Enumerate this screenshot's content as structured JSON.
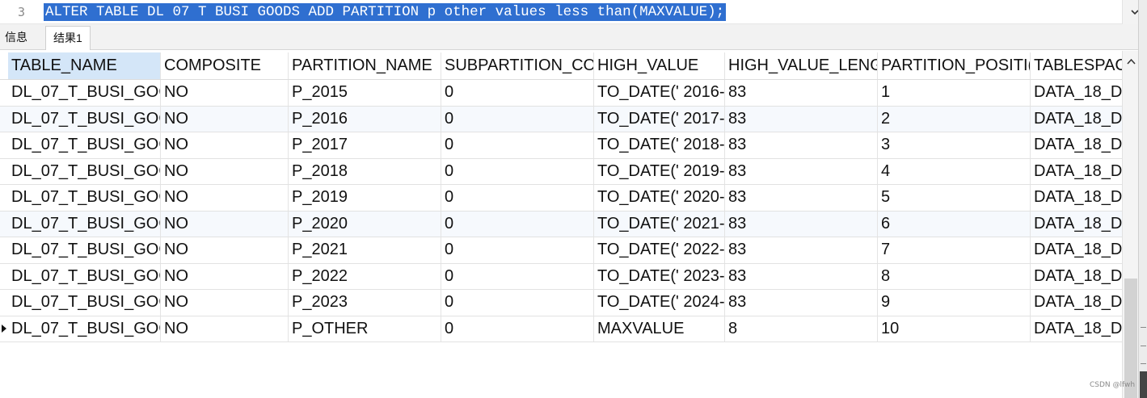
{
  "editor": {
    "line_number": "3",
    "sql": "ALTER TABLE DL 07 T BUSI GOODS ADD PARTITION p other values less than(MAXVALUE);"
  },
  "tabs": {
    "info_label": "信息",
    "result_label": "结果1"
  },
  "table": {
    "columns": [
      "TABLE_NAME",
      "COMPOSITE",
      "PARTITION_NAME",
      "SUBPARTITION_CO",
      "HIGH_VALUE",
      "HIGH_VALUE_LENG",
      "PARTITION_POSITI(",
      "TABLESPAC"
    ],
    "rows": [
      [
        "DL_07_T_BUSI_GOO",
        "NO",
        "P_2015",
        "0",
        "TO_DATE(' 2016-",
        "83",
        "1",
        "DATA_18_D."
      ],
      [
        "DL_07_T_BUSI_GOO",
        "NO",
        "P_2016",
        "0",
        "TO_DATE(' 2017-",
        "83",
        "2",
        "DATA_18_D."
      ],
      [
        "DL_07_T_BUSI_GOO",
        "NO",
        "P_2017",
        "0",
        "TO_DATE(' 2018-",
        "83",
        "3",
        "DATA_18_D."
      ],
      [
        "DL_07_T_BUSI_GOO",
        "NO",
        "P_2018",
        "0",
        "TO_DATE(' 2019-",
        "83",
        "4",
        "DATA_18_D."
      ],
      [
        "DL_07_T_BUSI_GOO",
        "NO",
        "P_2019",
        "0",
        "TO_DATE(' 2020-",
        "83",
        "5",
        "DATA_18_D."
      ],
      [
        "DL_07_T_BUSI_GOO",
        "NO",
        "P_2020",
        "0",
        "TO_DATE(' 2021-",
        "83",
        "6",
        "DATA_18_D."
      ],
      [
        "DL_07_T_BUSI_GOO",
        "NO",
        "P_2021",
        "0",
        "TO_DATE(' 2022-",
        "83",
        "7",
        "DATA_18_D."
      ],
      [
        "DL_07_T_BUSI_GOO",
        "NO",
        "P_2022",
        "0",
        "TO_DATE(' 2023-",
        "83",
        "8",
        "DATA_18_D."
      ],
      [
        "DL_07_T_BUSI_GOO",
        "NO",
        "P_2023",
        "0",
        "TO_DATE(' 2024-",
        "83",
        "9",
        "DATA_18_D."
      ],
      [
        "DL_07_T_BUSI_GOO",
        "NO",
        "P_OTHER",
        "0",
        "MAXVALUE",
        "8",
        "10",
        "DATA_18_D."
      ]
    ],
    "current_row_index": 9
  },
  "watermark": "CSDN @lfwh",
  "colors": {
    "selection": "#2f6fd0",
    "header_selected": "#d4e6f8"
  }
}
